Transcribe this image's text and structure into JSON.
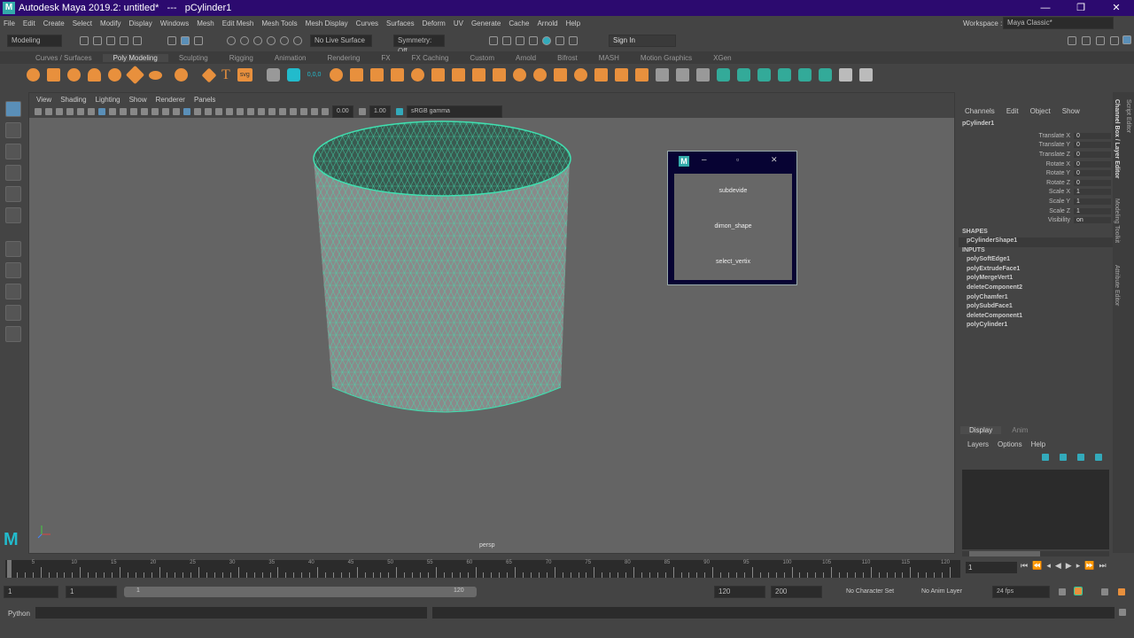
{
  "window": {
    "title": "Autodesk Maya 2019.2: untitled*   ---   pCylinder1",
    "logo": "M",
    "minimize": "—",
    "restore": "❐",
    "close": "✕"
  },
  "menu": [
    "File",
    "Edit",
    "Create",
    "Select",
    "Modify",
    "Display",
    "Windows",
    "Mesh",
    "Edit Mesh",
    "Mesh Tools",
    "Mesh Display",
    "Curves",
    "Surfaces",
    "Deform",
    "UV",
    "Generate",
    "Cache",
    "Arnold",
    "Help"
  ],
  "workspace": {
    "label": "Workspace :",
    "value": "Maya Classic*"
  },
  "status": {
    "mode": "Modeling",
    "live_surface": "No Live Surface",
    "symmetry": "Symmetry: Off",
    "sign_in": "Sign In"
  },
  "shelf_tabs": [
    "Curves / Surfaces",
    "Poly Modeling",
    "Sculpting",
    "Rigging",
    "Animation",
    "Rendering",
    "FX",
    "FX Caching",
    "Custom",
    "Arnold",
    "Bifrost",
    "MASH",
    "Motion Graphics",
    "XGen"
  ],
  "shelf_active": "Poly Modeling",
  "shelf_icons": [
    "sphere",
    "cube",
    "cylinder",
    "cone",
    "torus",
    "plane",
    "disc",
    "platonic",
    "super-shape",
    "type",
    "svg",
    "sculpt",
    "timer",
    "zero"
  ],
  "shelf_svg": "svg",
  "shelf_zero": "0,0,0",
  "viewport": {
    "menu": [
      "View",
      "Shading",
      "Lighting",
      "Show",
      "Renderer",
      "Panels"
    ],
    "exposure": "0.00",
    "gamma": "1.00",
    "color_space": "sRGB gamma",
    "camera": "persp"
  },
  "tool_window": {
    "logo": "M",
    "buttons": [
      "subdevide",
      "dimon_shape",
      "select_vertix"
    ]
  },
  "channel_box": {
    "menu": [
      "Channels",
      "Edit",
      "Object",
      "Show"
    ],
    "object": "pCylinder1",
    "channels": [
      {
        "name": "Translate X",
        "value": "0"
      },
      {
        "name": "Translate Y",
        "value": "0"
      },
      {
        "name": "Translate Z",
        "value": "0"
      },
      {
        "name": "Rotate X",
        "value": "0"
      },
      {
        "name": "Rotate Y",
        "value": "0"
      },
      {
        "name": "Rotate Z",
        "value": "0"
      },
      {
        "name": "Scale X",
        "value": "1"
      },
      {
        "name": "Scale Y",
        "value": "1"
      },
      {
        "name": "Scale Z",
        "value": "1"
      },
      {
        "name": "Visibility",
        "value": "on"
      }
    ],
    "shapes_label": "SHAPES",
    "shape": "pCylinderShape1",
    "inputs_label": "INPUTS",
    "inputs": [
      "polySoftEdge1",
      "polyExtrudeFace1",
      "polyMergeVert1",
      "deleteComponent2",
      "polyChamfer1",
      "polySubdFace1",
      "deleteComponent1",
      "polyCylinder1"
    ]
  },
  "side_tabs": [
    "Channel Box / Layer Editor",
    "Modeling Toolkit",
    "Attribute Editor",
    "Script Editor"
  ],
  "layer_editor": {
    "tabs": [
      "Display",
      "Anim"
    ],
    "menu": [
      "Layers",
      "Options",
      "Help"
    ]
  },
  "timeline": {
    "ticks": [
      "5",
      "10",
      "15",
      "20",
      "25",
      "30",
      "35",
      "40",
      "45",
      "50",
      "55",
      "60",
      "65",
      "70",
      "75",
      "80",
      "85",
      "90",
      "95",
      "100",
      "105",
      "110",
      "115",
      "120"
    ],
    "current": "1"
  },
  "range": {
    "start": "1",
    "playback_start": "1",
    "slider_start": "1",
    "slider_end": "120",
    "playback_end": "120",
    "end": "200",
    "character_set": "No Character Set",
    "anim_layer": "No Anim Layer",
    "fps": "24 fps"
  },
  "command_line": {
    "language": "Python"
  },
  "colors": {
    "title": "#2c0a6f",
    "wire": "#3fe0b0",
    "accent": "#e8903d"
  }
}
